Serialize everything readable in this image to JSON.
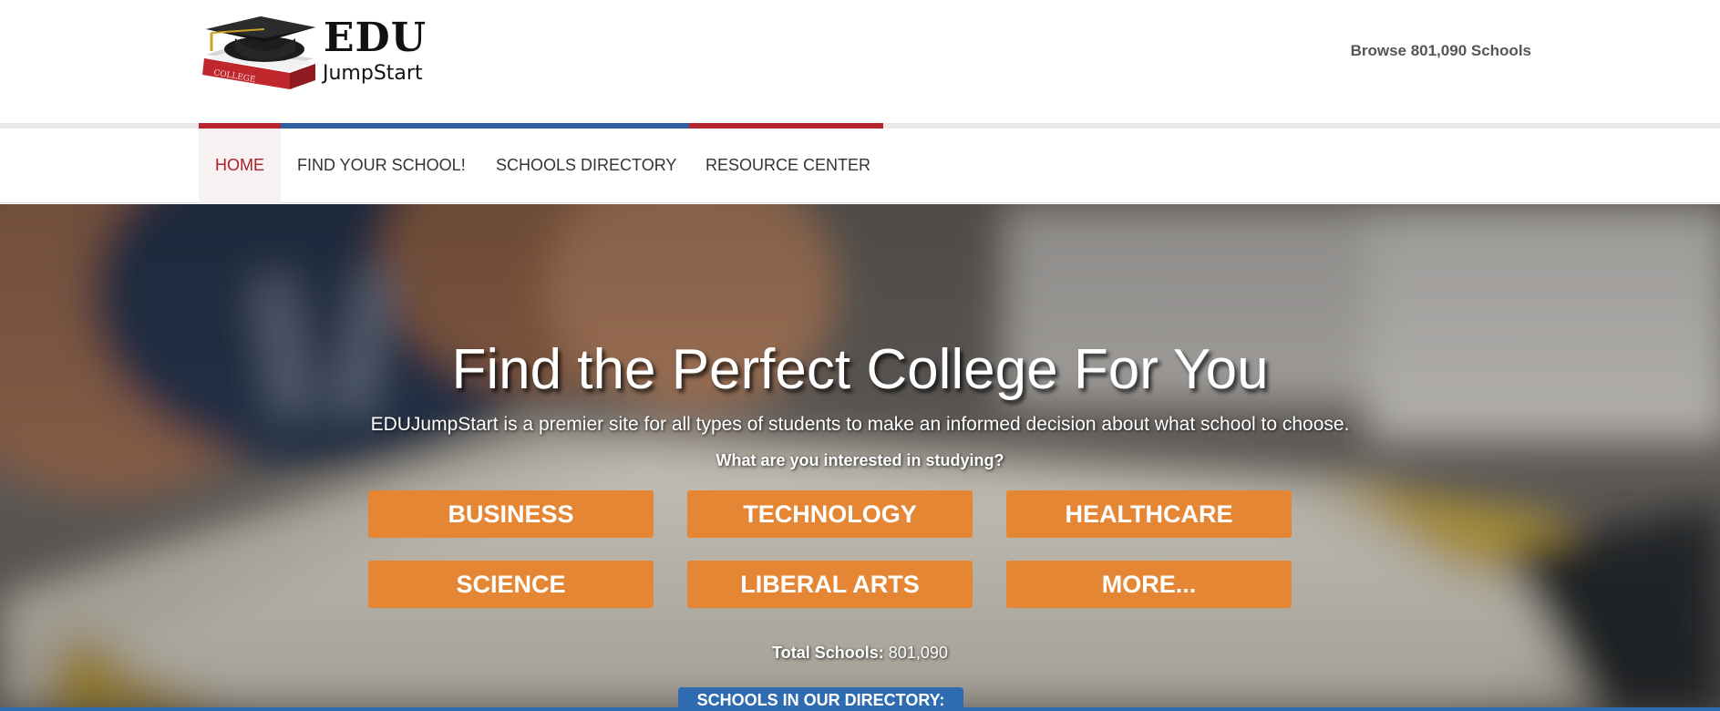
{
  "brand": {
    "name_big": "EDU",
    "name_small": "JumpStart",
    "book_text": "COLLEGE",
    "colors": {
      "red": "#c0272d",
      "blue": "#2f5f9f",
      "orange": "#e58634"
    }
  },
  "header": {
    "browse_label": "Browse 801,090 Schools"
  },
  "nav": {
    "items": [
      {
        "label": "HOME",
        "active": true
      },
      {
        "label": "FIND YOUR SCHOOL!"
      },
      {
        "label": "SCHOOLS DIRECTORY"
      },
      {
        "label": "RESOURCE CENTER"
      }
    ]
  },
  "hero": {
    "title": "Find the Perfect College For You",
    "subtitle": "EDUJumpStart is a premier site for all types of students to make an informed decision about what school to choose.",
    "question": "What are you interested in studying?",
    "categories": [
      "BUSINESS",
      "TECHNOLOGY",
      "HEALTHCARE",
      "SCIENCE",
      "LIBERAL ARTS",
      "MORE..."
    ],
    "total_label": "Total Schools:",
    "total_value": "801,090",
    "directory_tab": "SCHOOLS IN OUR DIRECTORY:",
    "background_icon": "open-book-photo"
  }
}
